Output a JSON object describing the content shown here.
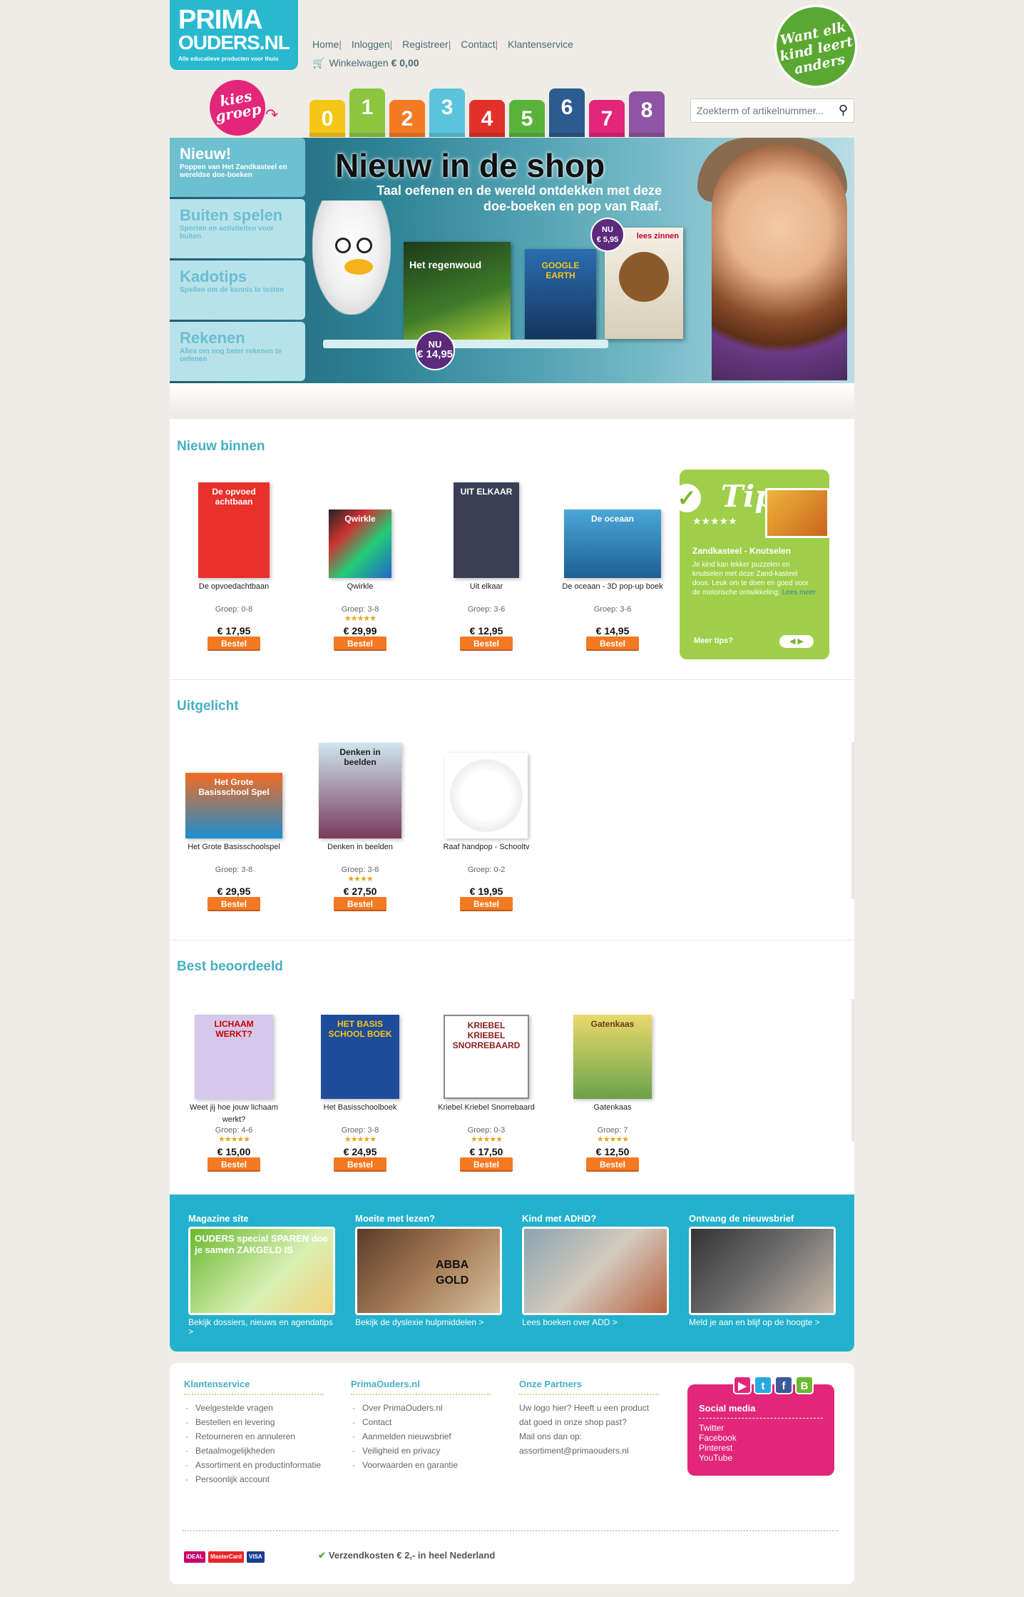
{
  "logo": {
    "line1": "PRIMA",
    "line2": "OUDERS.NL",
    "tagline": "Alle educatieve producten voor thuis"
  },
  "nav": {
    "items": [
      "Home",
      "Inloggen",
      "Registreer",
      "Contact",
      "Klantenservice"
    ]
  },
  "cart": {
    "label": "Winkelwagen",
    "amount": "€ 0,00"
  },
  "badge": {
    "text": "Want elk kind leert anders"
  },
  "kies_groep": "kies groep",
  "groups": [
    {
      "label": "0",
      "color": "#f5c618"
    },
    {
      "label": "1",
      "color": "#8cc63f"
    },
    {
      "label": "2",
      "color": "#f37a22"
    },
    {
      "label": "3",
      "color": "#5bc4dc"
    },
    {
      "label": "4",
      "color": "#e2312b"
    },
    {
      "label": "5",
      "color": "#59b33b"
    },
    {
      "label": "6",
      "color": "#2c5c8f"
    },
    {
      "label": "7",
      "color": "#e2267a"
    },
    {
      "label": "8",
      "color": "#8e55a3"
    }
  ],
  "search": {
    "placeholder": "Zoekterm of artikelnummer..."
  },
  "hero": {
    "tabs": [
      {
        "title": "Nieuw!",
        "sub": "Poppen van Het Zandkasteel en wereldse doe-boeken"
      },
      {
        "title": "Buiten spelen",
        "sub": "Sporten en activiteiten voor buiten"
      },
      {
        "title": "Kadotips",
        "sub": "Spellen om de kennis te testen"
      },
      {
        "title": "Rekenen",
        "sub": "Alles om nog beter rekenen te oefenen"
      }
    ],
    "title": "Nieuw in de shop",
    "subtitle": "Taal oefenen en de wereld ontdekken met deze doe-boeken en pop van Raaf.",
    "books": [
      "Het regenwoud",
      "GOOGLE EARTH",
      "lees zinnen"
    ],
    "bubble1": {
      "l1": "NU",
      "l2": "€ 14,95"
    },
    "bubble2": {
      "l1": "NU",
      "l2": "€ 5,95"
    }
  },
  "sections": [
    {
      "title": "Nieuw binnen",
      "products": [
        {
          "name": "De opvoedachtbaan",
          "group": "Groep: 0-8",
          "stars": "",
          "price": "€ 17,95",
          "btn": "Bestel",
          "cover": "De opvoed achtbaan"
        },
        {
          "name": "Qwirkle",
          "group": "Groep: 3-8",
          "stars": "★★★★★",
          "price": "€ 29,99",
          "btn": "Bestel",
          "cover": "Qwirkle"
        },
        {
          "name": "Uit elkaar",
          "group": "Groep: 3-6",
          "stars": "",
          "price": "€ 12,95",
          "btn": "Bestel",
          "cover": "UIT ELKAAR"
        },
        {
          "name": "De oceaan - 3D pop-up boek",
          "group": "Groep: 3-6",
          "stars": "",
          "price": "€ 14,95",
          "btn": "Bestel",
          "cover": "De oceaan"
        }
      ]
    },
    {
      "title": "Uitgelicht",
      "products": [
        {
          "name": "Het Grote Basisschoolspel",
          "group": "Groep: 3-8",
          "stars": "",
          "price": "€ 29,95",
          "btn": "Bestel",
          "cover": "Het Grote Basisschool Spel"
        },
        {
          "name": "Denken in beelden",
          "group": "Groep: 3-8",
          "stars": "★★★★",
          "price": "€ 27,50",
          "btn": "Bestel",
          "cover": "Denken in beelden"
        },
        {
          "name": "Raaf handpop - Schooltv",
          "group": "Groep: 0-2",
          "stars": "",
          "price": "€ 19,95",
          "btn": "Bestel",
          "cover": ""
        }
      ]
    },
    {
      "title": "Best beoordeeld",
      "products": [
        {
          "name": "Weet jij hoe jouw lichaam werkt?",
          "group": "Groep: 4-6",
          "stars": "★★★★★",
          "price": "€ 15,00",
          "btn": "Bestel",
          "cover": "LICHAAM WERKT?"
        },
        {
          "name": "Het Basisschoolboek",
          "group": "Groep: 3-8",
          "stars": "★★★★★",
          "price": "€ 24,95",
          "btn": "Bestel",
          "cover": "HET BASIS SCHOOL BOEK"
        },
        {
          "name": "Kriebel Kriebel Snorrebaard",
          "group": "Groep: 0-3",
          "stars": "★★★★★",
          "price": "€ 17,50",
          "btn": "Bestel",
          "cover": "KRIEBEL KRIEBEL SNORREBAARD"
        },
        {
          "name": "Gatenkaas",
          "group": "Groep: 7",
          "stars": "★★★★★",
          "price": "€ 12,50",
          "btn": "Bestel",
          "cover": "Gatenkaas"
        }
      ]
    }
  ],
  "tip": {
    "title": "Tip",
    "stars": "★★★★★",
    "heading": "Zandkasteel - Knutselen",
    "body": "Je kind kan lekker puzzelen en knutselen met deze Zand-kasteel doos. Leuk om te doen en goed voor de motorische ontwikkeling.",
    "link": "Lees meer",
    "more": "Meer tips?"
  },
  "band": [
    {
      "title": "Magazine site",
      "link": "Bekijk dossiers, nieuws en agendatips >",
      "img": "OUDERS special SPAREN doe je samen ZAKGELD IS"
    },
    {
      "title": "Moeite met lezen?",
      "link": "Bekijk de dyslexie hulpmiddelen >",
      "img": "ABBA GOLD"
    },
    {
      "title": "Kind met ADHD?",
      "link": "Lees boeken over ADD >",
      "img": ""
    },
    {
      "title": "Ontvang de nieuwsbrief",
      "link": "Meld je aan en blijf op de hoogte >",
      "img": ""
    }
  ],
  "footer": {
    "klantenservice": {
      "title": "Klantenservice",
      "items": [
        "Veelgestelde vragen",
        "Bestellen en levering",
        "Retourneren en annuleren",
        "Betaalmogelijkheden",
        "Assortiment en productinformatie",
        "Persoonlijk account"
      ]
    },
    "prima": {
      "title": "PrimaOuders.nl",
      "items": [
        "Over PrimaOuders.nl",
        "Contact",
        "Aanmelden nieuwsbrief",
        "Veiligheid en privacy",
        "Voorwaarden en garantie"
      ]
    },
    "partners": {
      "title": "Onze Partners",
      "text1": "Uw logo hier? Heeft u een product dat goed in onze shop past?",
      "text2": "Mail ons dan op:",
      "email": "assortiment@primaouders.nl"
    },
    "social": {
      "title": "Social media",
      "items": [
        "Twitter",
        "Facebook",
        "Pinterest",
        "YouTube"
      ]
    },
    "shipping": "Verzendkosten € 2,- in heel Nederland",
    "payments": [
      "iDEAL",
      "MasterCard",
      "VISA"
    ]
  }
}
